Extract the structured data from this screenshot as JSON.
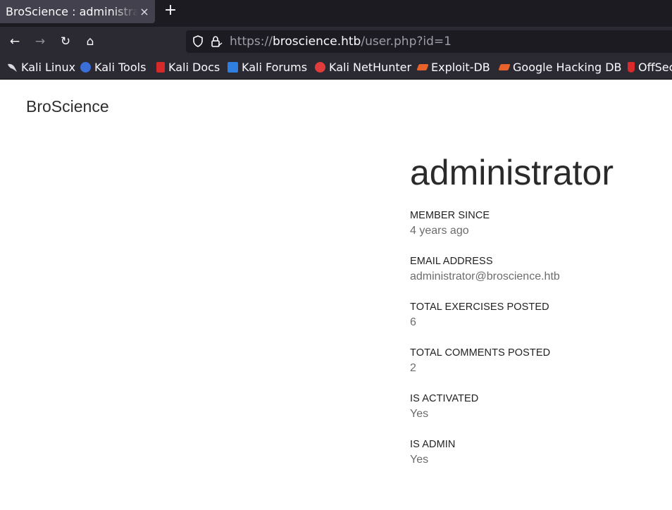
{
  "browser": {
    "tab": {
      "title": "BroScience : administrator",
      "close_glyph": "×"
    },
    "new_tab_glyph": "+",
    "nav": {
      "back_glyph": "←",
      "forward_glyph": "→",
      "reload_glyph": "↻",
      "home_glyph": "⌂"
    },
    "url": {
      "scheme": "https://",
      "host": "broscience.htb",
      "path": "/user.php?id=1"
    },
    "bookmarks": [
      {
        "label": "Kali Linux",
        "icon": "kali-dragon-icon",
        "color": "#3b3b3b"
      },
      {
        "label": "Kali Tools",
        "icon": "kali-tools-icon",
        "color": "#3a6fd8"
      },
      {
        "label": "Kali Docs",
        "icon": "kali-docs-icon",
        "color": "#d62a2a"
      },
      {
        "label": "Kali Forums",
        "icon": "kali-forums-icon",
        "color": "#2f7fe0"
      },
      {
        "label": "Kali NetHunter",
        "icon": "kali-nethunter-icon",
        "color": "#e03c3c"
      },
      {
        "label": "Exploit-DB",
        "icon": "exploit-db-icon",
        "color": "#e8632b"
      },
      {
        "label": "Google Hacking DB",
        "icon": "ghdb-icon",
        "color": "#e8632b"
      },
      {
        "label": "OffSec",
        "icon": "offsec-icon",
        "color": "#d92b2b"
      }
    ]
  },
  "page": {
    "brand": "BroScience",
    "profile": {
      "username": "administrator",
      "fields": [
        {
          "label": "MEMBER SINCE",
          "value": "4 years ago"
        },
        {
          "label": "EMAIL ADDRESS",
          "value": "administrator@broscience.htb"
        },
        {
          "label": "TOTAL EXERCISES POSTED",
          "value": "6"
        },
        {
          "label": "TOTAL COMMENTS POSTED",
          "value": "2"
        },
        {
          "label": "IS ACTIVATED",
          "value": "Yes"
        },
        {
          "label": "IS ADMIN",
          "value": "Yes"
        }
      ]
    }
  }
}
